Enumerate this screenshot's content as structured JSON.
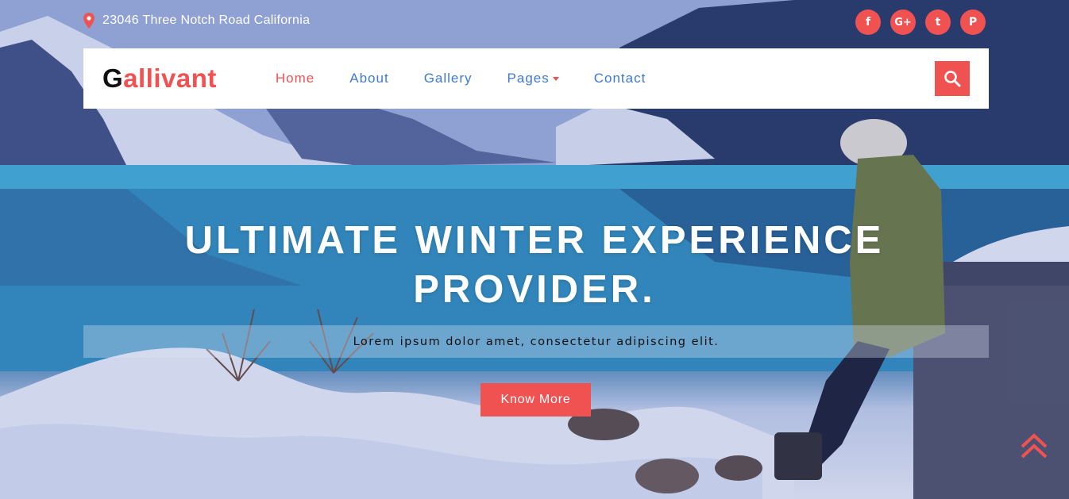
{
  "topbar": {
    "address": "23046 Three Notch Road California",
    "address_icon": "map-pin-icon",
    "social": [
      {
        "name": "facebook",
        "glyph": "f"
      },
      {
        "name": "google-plus",
        "glyph": "G+"
      },
      {
        "name": "twitter",
        "glyph": "t"
      },
      {
        "name": "pinterest",
        "glyph": "P"
      }
    ]
  },
  "nav": {
    "logo_first": "G",
    "logo_rest": "allivant",
    "items": [
      {
        "label": "Home",
        "active": true
      },
      {
        "label": "About",
        "active": false
      },
      {
        "label": "Gallery",
        "active": false
      },
      {
        "label": "Pages",
        "active": false,
        "dropdown": true
      },
      {
        "label": "Contact",
        "active": false
      }
    ],
    "search_icon": "search-icon"
  },
  "hero": {
    "headline_line1": "ULTIMATE WINTER EXPERIENCE",
    "headline_line2": "PROVIDER.",
    "subtitle": "Lorem ipsum dolor amet, consectetur adipiscing elit.",
    "cta_label": "Know More"
  },
  "colors": {
    "accent": "#f05252",
    "nav_link": "#3f7ad0",
    "white": "#ffffff"
  }
}
